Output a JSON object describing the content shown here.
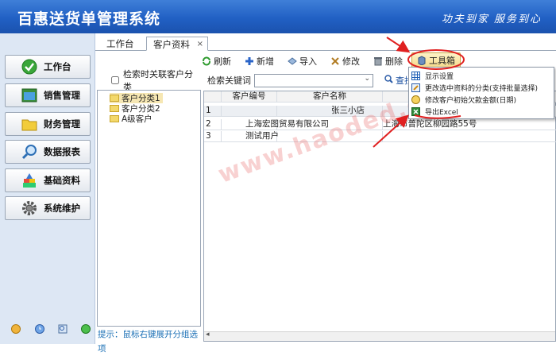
{
  "header": {
    "title": "百惠送货单管理系统",
    "slogan": "功夫到家 服务到心"
  },
  "sidebar": {
    "items": [
      {
        "label": "工作台",
        "icon": "check-circle-icon"
      },
      {
        "label": "销售管理",
        "icon": "window-icon"
      },
      {
        "label": "财务管理",
        "icon": "folder-icon"
      },
      {
        "label": "数据报表",
        "icon": "magnifier-icon"
      },
      {
        "label": "基础资料",
        "icon": "building-blocks-icon"
      },
      {
        "label": "系统维护",
        "icon": "gear-icon"
      }
    ],
    "footer_icons": [
      "help-icon",
      "clock-icon",
      "search-doc-icon",
      "globe-icon"
    ]
  },
  "tabs": [
    {
      "label": "工作台"
    },
    {
      "label": "客户资料"
    }
  ],
  "tab_close": "×",
  "toolbar": {
    "refresh": "刷新",
    "add": "新增",
    "import": "导入",
    "edit": "修改",
    "delete": "删除",
    "toolbox": "工具箱"
  },
  "tree": {
    "checkbox_label": "检索时关联客户分类",
    "checked": false,
    "items": [
      "客户分类1",
      "客户分类2",
      "A级客户"
    ],
    "hint": "提示：鼠标右键展开分组选项"
  },
  "search": {
    "label": "检索关键词",
    "value": "",
    "button": "查找..."
  },
  "grid": {
    "columns": [
      "",
      "客户编号",
      "客户名称",
      ""
    ],
    "rows": [
      [
        "1",
        "",
        "张三小店",
        ""
      ],
      [
        "2",
        "",
        "上海宏图贸易有限公司",
        "上海市普陀区柳园路55号"
      ],
      [
        "3",
        "",
        "测试用户",
        ""
      ]
    ]
  },
  "toolbox_menu": {
    "items": [
      {
        "label": "显示设置",
        "icon": "grid-icon"
      },
      {
        "label": "更改选中资料的分类(支持批量选择)",
        "icon": "edit-window-icon"
      },
      {
        "label": "修改客户初始欠款金额(日期)",
        "icon": "money-icon"
      },
      {
        "label": "导出Excel",
        "icon": "excel-icon"
      }
    ]
  },
  "watermark": "www.haoded.com",
  "colors": {
    "header_top": "#3f7fd8",
    "header_bottom": "#1b52ae",
    "annotation": "#e02020",
    "link": "#1a6fb5"
  }
}
